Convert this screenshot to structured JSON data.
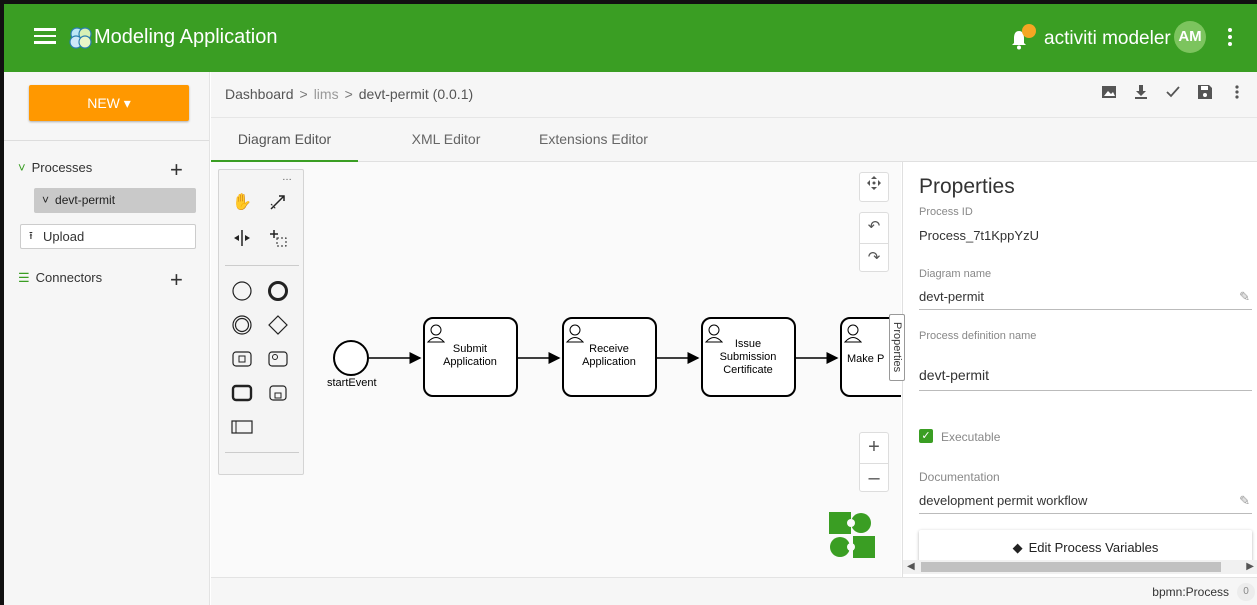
{
  "app": {
    "title": "Modeling Application",
    "user_name": "activiti modeler",
    "user_initials": "AM",
    "brand_color": "#3a9e23",
    "accent_color": "#ff9800"
  },
  "sidebar": {
    "new_label": "NEW ▾",
    "processes_label": "Processes",
    "process_items": [
      {
        "label": "devt-permit"
      }
    ],
    "upload_label": "Upload",
    "connectors_label": "Connectors",
    "add_glyph": "+"
  },
  "breadcrumb": {
    "home": "Dashboard",
    "project": "lims",
    "current": "devt-permit (0.0.1)",
    "separator": ">"
  },
  "toolbar": {
    "icons": [
      "image-icon",
      "download-icon",
      "validate-icon",
      "save-icon",
      "more-icon"
    ]
  },
  "tabs": [
    {
      "label": "Diagram Editor",
      "active": true
    },
    {
      "label": "XML Editor",
      "active": false
    },
    {
      "label": "Extensions Editor",
      "active": false
    }
  ],
  "diagram": {
    "start_event_label": "startEvent",
    "tasks": [
      {
        "line1": "Submit",
        "line2": "Application",
        "line3": ""
      },
      {
        "line1": "Receive",
        "line2": "Application",
        "line3": ""
      },
      {
        "line1": "Issue",
        "line2": "Submission",
        "line3": "Certificate"
      },
      {
        "line1": "Make P",
        "line2": "",
        "line3": ""
      }
    ]
  },
  "properties": {
    "tab_label": "Properties",
    "title": "Properties",
    "process_id_label": "Process ID",
    "process_id": "Process_7t1KppYzU",
    "diagram_name_label": "Diagram name",
    "diagram_name": "devt-permit",
    "process_def_label": "Process definition name",
    "process_def_name": "devt-permit",
    "executable_label": "Executable",
    "executable": true,
    "documentation_label": "Documentation",
    "documentation": "development permit workflow",
    "edit_vars_label": "Edit Process Variables"
  },
  "status": {
    "element_type": "bpmn:Process",
    "count": "0"
  }
}
